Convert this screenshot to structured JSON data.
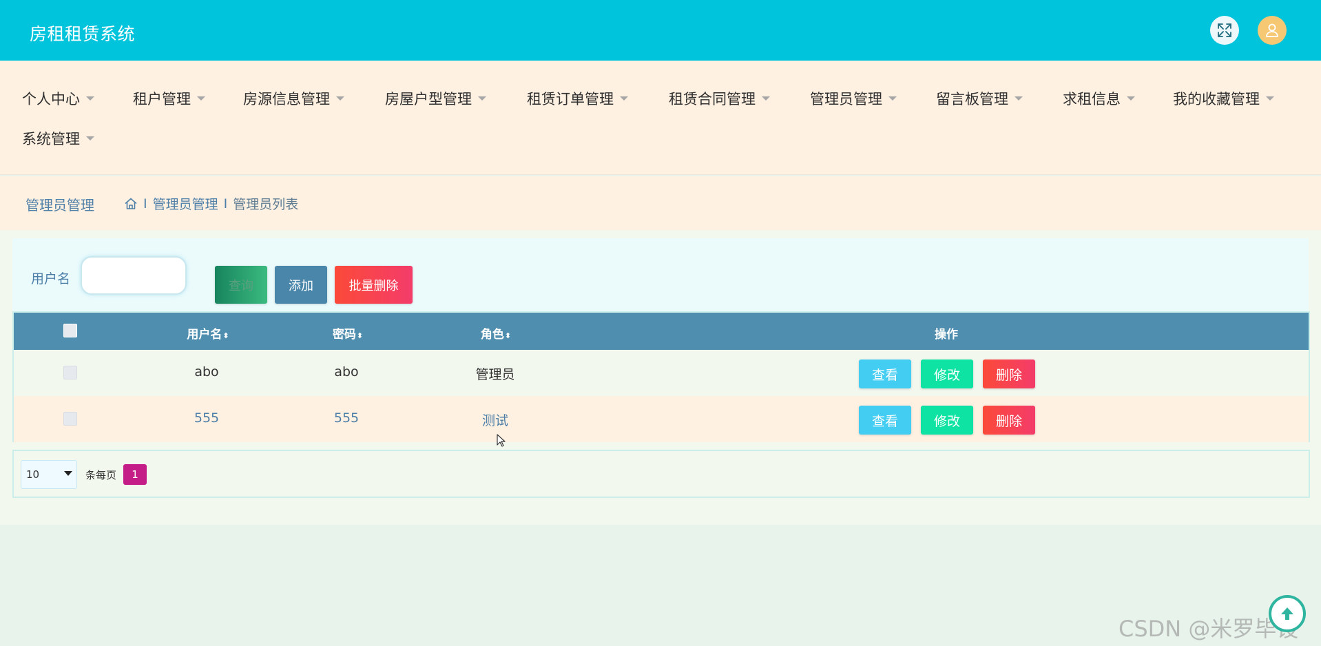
{
  "app": {
    "title": "房租租赁系统"
  },
  "header_icons": [
    "fullscreen-icon",
    "user-icon"
  ],
  "nav": {
    "items": [
      {
        "label": "个人中心"
      },
      {
        "label": "租户管理"
      },
      {
        "label": "房源信息管理"
      },
      {
        "label": "房屋户型管理"
      },
      {
        "label": "租赁订单管理"
      },
      {
        "label": "租赁合同管理"
      },
      {
        "label": "管理员管理"
      },
      {
        "label": "留言板管理"
      },
      {
        "label": "求租信息"
      },
      {
        "label": "我的收藏管理"
      },
      {
        "label": "系统管理"
      }
    ]
  },
  "breadcrumb": {
    "title": "管理员管理",
    "separator": "I",
    "items": [
      "管理员管理",
      "管理员列表"
    ]
  },
  "search": {
    "label": "用户名",
    "value": "",
    "placeholder": "",
    "query_label": "查询",
    "add_label": "添加",
    "batch_delete_label": "批量删除"
  },
  "table": {
    "columns": [
      "用户名",
      "密码",
      "角色",
      "操作"
    ],
    "rows": [
      {
        "username": "abo",
        "password": "abo",
        "role": "管理员"
      },
      {
        "username": "555",
        "password": "555",
        "role": "测试"
      }
    ],
    "actions": {
      "view": "查看",
      "edit": "修改",
      "delete": "删除"
    }
  },
  "pagination": {
    "page_size": "10",
    "per_page_label": "条每页",
    "current_page": "1"
  },
  "watermark": "CSDN @米罗毕设",
  "colors": {
    "header": "#00c3dc",
    "nav_bg": "#fff1e2",
    "table_header": "#4f8eaf",
    "view_button": "#43cdf3",
    "edit_button": "#0fe3a3",
    "delete_button": "#f43c6a",
    "active_page": "#c51d87"
  }
}
